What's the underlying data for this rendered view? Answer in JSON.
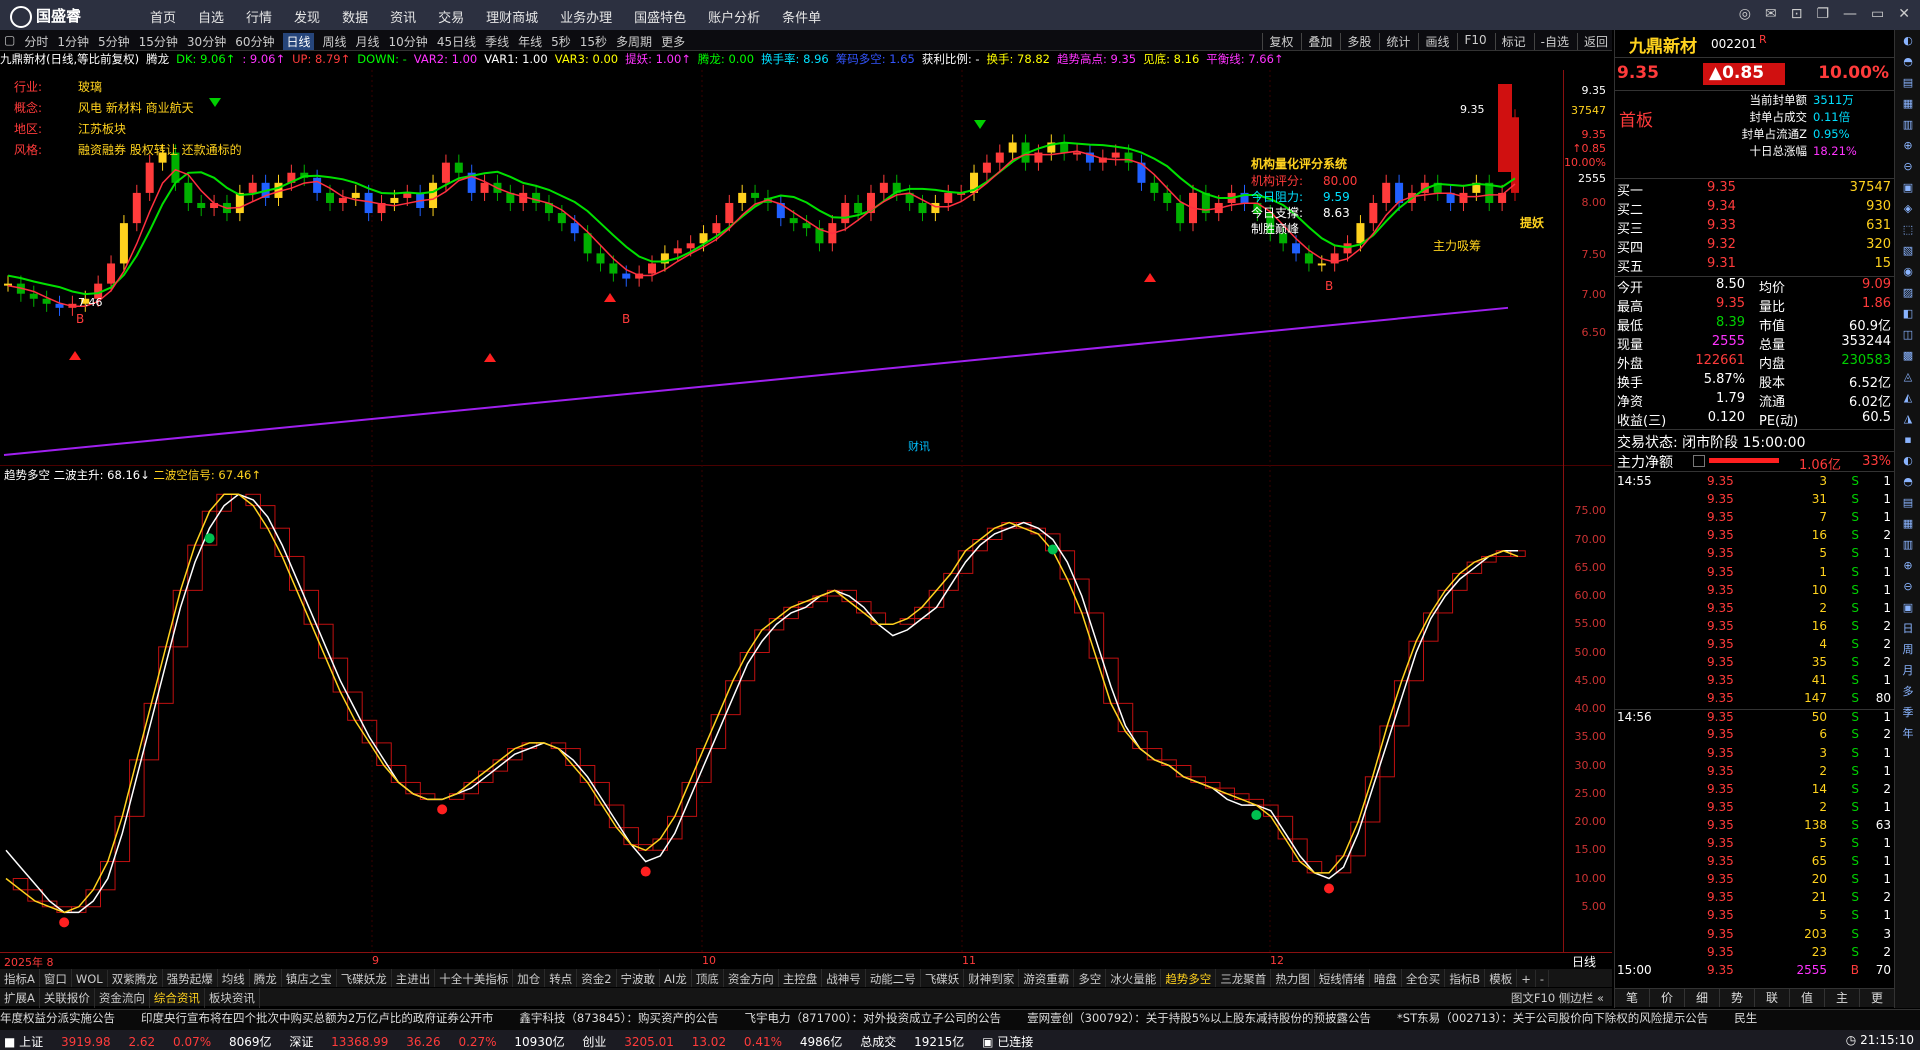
{
  "topbar": {
    "logo": "国盛睿",
    "menu": [
      "首页",
      "自选",
      "行情",
      "发现",
      "数据",
      "资讯",
      "交易",
      "理财商城",
      "业务办理",
      "国盛特色",
      "账户分析",
      "条件单"
    ]
  },
  "periodbar": {
    "items": [
      "分时",
      "1分钟",
      "5分钟",
      "15分钟",
      "30分钟",
      "60分钟",
      "日线",
      "周线",
      "月线",
      "10分钟",
      "45日线",
      "季线",
      "年线",
      "5秒",
      "15秒",
      "多周期",
      "更多"
    ],
    "active_index": 6,
    "right": [
      "复权",
      "叠加",
      "多股",
      "统计",
      "画线",
      "F10",
      "标记",
      "-自选",
      "返回"
    ]
  },
  "indicator_line": [
    {
      "t": "九鼎新材(日线,等比前复权)",
      "c": "#ffffff"
    },
    {
      "t": "腾龙",
      "c": "#ffffff"
    },
    {
      "t": "DK: 9.06↑",
      "c": "#00ff00"
    },
    {
      "t": ": 9.06↑",
      "c": "#ff33ff"
    },
    {
      "t": "UP: 8.79↑",
      "c": "#ff3b3b"
    },
    {
      "t": "DOWN: -",
      "c": "#00ff00"
    },
    {
      "t": "VAR2: 1.00",
      "c": "#ff33ff"
    },
    {
      "t": "VAR1: 1.00",
      "c": "#ffffff"
    },
    {
      "t": "VAR3: 0.00",
      "c": "#ffff00"
    },
    {
      "t": "提妖: 1.00↑",
      "c": "#ff33ff"
    },
    {
      "t": "腾龙: 0.00",
      "c": "#00ff00"
    },
    {
      "t": "换手率: 8.96",
      "c": "#00e0ff"
    },
    {
      "t": "筹码多空: 1.65",
      "c": "#3355ff"
    },
    {
      "t": "获利比例: -",
      "c": "#ffffff"
    },
    {
      "t": "换手: 78.82",
      "c": "#ffff00"
    },
    {
      "t": "趋势高点: 9.35",
      "c": "#ff33ff"
    },
    {
      "t": "见底: 8.16",
      "c": "#ffff00"
    },
    {
      "t": "平衡线: 7.66↑",
      "c": "#ff33ff"
    }
  ],
  "stock_info": [
    {
      "label": "行业:",
      "value": "玻璃"
    },
    {
      "label": "概念:",
      "value": "风电 新材料 商业航天"
    },
    {
      "label": "地区:",
      "value": "江苏板块"
    },
    {
      "label": "风格:",
      "value": "融资融券 股权转让 还款通标的"
    }
  ],
  "rating_box": {
    "title": "机构量化评分系统",
    "lines": [
      {
        "label": "机构评分:",
        "value": "80.00",
        "c": "#ff3b3b"
      },
      {
        "label": "今日阻力:",
        "value": "9.59",
        "c": "#00e0ff"
      },
      {
        "label": "今日支撑:",
        "value": "8.63",
        "c": "#ffffff"
      },
      {
        "label": "制胜巅峰",
        "value": "",
        "c": "#ffffff"
      }
    ]
  },
  "chart_labels": {
    "high_price": "9.35",
    "low_price": "7.46",
    "b_label": "B",
    "tiyao": "提妖",
    "zhuli": "主力吸筹",
    "caixun": "财讯"
  },
  "osc_header": {
    "name": "趋势多空",
    "a": "二波主升: 68.16↓",
    "b": "二波空信号: 67.46↑"
  },
  "price_scale": [
    "9.35",
    "37547",
    "9.35",
    "↑0.85",
    "10.00%",
    "2555",
    "8.00",
    "7.50",
    "7.00",
    "6.50"
  ],
  "osc_scale": [
    "75.00",
    "70.00",
    "65.00",
    "60.00",
    "55.00",
    "50.00",
    "45.00",
    "40.00",
    "35.00",
    "30.00",
    "25.00",
    "20.00",
    "15.00",
    "10.00",
    "5.00"
  ],
  "dates": {
    "year_label": "2025年 8",
    "labels": [
      "9",
      "10",
      "11",
      "12"
    ],
    "period": "日线"
  },
  "chart_data": {
    "type": "candlestick",
    "price_series": {
      "open": [
        7.7,
        7.7,
        7.6,
        7.55,
        7.5,
        7.46,
        7.5,
        7.55,
        7.7,
        7.9,
        8.3,
        8.6,
        8.9,
        9.0,
        8.7,
        8.5,
        8.45,
        8.5,
        8.4,
        8.6,
        8.7,
        8.55,
        8.7,
        8.8,
        8.75,
        8.6,
        8.5,
        8.55,
        8.6,
        8.4,
        8.5,
        8.55,
        8.6,
        8.45,
        8.7,
        8.9,
        8.8,
        8.6,
        8.7,
        8.6,
        8.5,
        8.6,
        8.5,
        8.4,
        8.3,
        8.2,
        8.0,
        7.9,
        7.8,
        7.75,
        7.8,
        7.9,
        8.0,
        8.05,
        8.1,
        8.2,
        8.3,
        8.5,
        8.6,
        8.55,
        8.5,
        8.35,
        8.3,
        8.25,
        8.1,
        8.3,
        8.5,
        8.4,
        8.6,
        8.7,
        8.6,
        8.5,
        8.4,
        8.5,
        8.6,
        8.6,
        8.8,
        8.9,
        9.0,
        9.1,
        8.9,
        9.0,
        9.1,
        9.0,
        9.0,
        8.9,
        8.95,
        9.0,
        8.9,
        8.7,
        8.6,
        8.5,
        8.3,
        8.6,
        8.4,
        8.5,
        8.6,
        8.5,
        8.4,
        8.2,
        8.1,
        8.0,
        7.9,
        7.9,
        8.0,
        8.1,
        8.3,
        8.5,
        8.7,
        8.5,
        8.6,
        8.7,
        8.6,
        8.5,
        8.6,
        8.7,
        8.5,
        8.6
      ],
      "close": [
        7.7,
        7.6,
        7.55,
        7.5,
        7.46,
        7.5,
        7.55,
        7.7,
        7.9,
        8.3,
        8.6,
        8.9,
        9.0,
        8.7,
        8.5,
        8.45,
        8.5,
        8.4,
        8.6,
        8.7,
        8.55,
        8.7,
        8.8,
        8.75,
        8.6,
        8.5,
        8.55,
        8.6,
        8.4,
        8.5,
        8.55,
        8.6,
        8.45,
        8.7,
        8.9,
        8.8,
        8.6,
        8.7,
        8.6,
        8.5,
        8.6,
        8.5,
        8.4,
        8.3,
        8.2,
        8.0,
        7.9,
        7.8,
        7.75,
        7.8,
        7.9,
        8.0,
        8.05,
        8.1,
        8.2,
        8.3,
        8.5,
        8.6,
        8.55,
        8.5,
        8.35,
        8.3,
        8.25,
        8.1,
        8.3,
        8.5,
        8.4,
        8.6,
        8.7,
        8.6,
        8.5,
        8.4,
        8.5,
        8.6,
        8.6,
        8.8,
        8.9,
        9.0,
        9.1,
        8.9,
        9.0,
        9.1,
        9.0,
        9.0,
        8.9,
        8.95,
        9.0,
        8.9,
        8.7,
        8.6,
        8.5,
        8.3,
        8.6,
        8.4,
        8.5,
        8.6,
        8.5,
        8.4,
        8.2,
        8.1,
        8.0,
        7.9,
        7.9,
        8.0,
        8.1,
        8.3,
        8.5,
        8.7,
        8.5,
        8.6,
        8.7,
        8.6,
        8.5,
        8.6,
        8.7,
        8.5,
        8.6,
        9.35
      ],
      "ma_long_start": 6.0,
      "ma_long_end": 7.46,
      "price_range": [
        6.0,
        9.7
      ]
    },
    "osc_series": {
      "white": [
        15,
        12,
        9,
        6,
        4,
        4,
        6,
        10,
        18,
        28,
        38,
        48,
        58,
        66,
        72,
        76,
        78,
        77,
        74,
        69,
        63,
        57,
        51,
        45,
        40,
        35,
        31,
        27,
        25,
        24,
        24,
        25,
        26,
        28,
        30,
        32,
        33,
        34,
        33,
        31,
        28,
        24,
        20,
        16,
        13,
        14,
        18,
        24,
        30,
        36,
        42,
        48,
        52,
        55,
        57,
        58,
        60,
        61,
        60,
        58,
        55,
        53,
        54,
        56,
        58,
        62,
        66,
        69,
        71,
        72,
        73,
        72,
        70,
        66,
        60,
        52,
        44,
        37,
        33,
        31,
        30,
        28,
        27,
        26,
        24,
        23,
        23,
        22,
        18,
        14,
        11,
        10,
        12,
        18,
        26,
        34,
        42,
        50,
        56,
        60,
        63,
        65,
        67,
        68,
        68
      ],
      "yellow": [
        10,
        8,
        6,
        5,
        4,
        5,
        8,
        13,
        21,
        31,
        41,
        51,
        61,
        69,
        75,
        78,
        78,
        76,
        72,
        67,
        61,
        55,
        49,
        43,
        38,
        34,
        30,
        27,
        25,
        24,
        24,
        25,
        27,
        29,
        31,
        33,
        34,
        34,
        33,
        30,
        27,
        23,
        19,
        16,
        15,
        17,
        21,
        27,
        33,
        39,
        45,
        50,
        54,
        56,
        58,
        59,
        60,
        61,
        59,
        57,
        55,
        55,
        56,
        58,
        61,
        64,
        68,
        70,
        72,
        73,
        72,
        71,
        68,
        63,
        57,
        49,
        41,
        36,
        33,
        31,
        30,
        28,
        27,
        26,
        25,
        24,
        23,
        21,
        17,
        13,
        11,
        11,
        14,
        20,
        28,
        37,
        45,
        52,
        57,
        61,
        64,
        66,
        67,
        68,
        67
      ],
      "y_range": [
        0,
        80
      ]
    }
  },
  "quote": {
    "name": "九鼎新材",
    "code": "002201",
    "flag": "R",
    "price": "9.35",
    "change": "▲0.85",
    "pct": "10.00%",
    "board": "首板",
    "seal_stats": [
      {
        "label": "当前封单额",
        "value": "3511万"
      },
      {
        "label": "封单占成交",
        "value": "0.11倍"
      },
      {
        "label": "封单占流通Z",
        "value": "0.95%"
      },
      {
        "label": "十日总涨幅",
        "value": "18.21%"
      }
    ],
    "buy_levels": [
      {
        "label": "买一",
        "price": "9.35",
        "vol": "37547"
      },
      {
        "label": "买二",
        "price": "9.34",
        "vol": "930"
      },
      {
        "label": "买三",
        "price": "9.33",
        "vol": "631"
      },
      {
        "label": "买四",
        "price": "9.32",
        "vol": "320"
      },
      {
        "label": "买五",
        "price": "9.31",
        "vol": "15"
      }
    ],
    "stats": [
      {
        "l1": "今开",
        "v1": "8.50",
        "c1": "#ffffff",
        "l2": "均价",
        "v2": "9.09",
        "c2": "#ff3b3b"
      },
      {
        "l1": "最高",
        "v1": "9.35",
        "c1": "#ff3b3b",
        "l2": "量比",
        "v2": "1.86",
        "c2": "#ff3b3b"
      },
      {
        "l1": "最低",
        "v1": "8.39",
        "c1": "#00d000",
        "l2": "市值",
        "v2": "60.9亿",
        "c2": "#ffffff"
      },
      {
        "l1": "现量",
        "v1": "2555",
        "c1": "#ff33ff",
        "l2": "总量",
        "v2": "353244",
        "c2": "#ffffff"
      },
      {
        "l1": "外盘",
        "v1": "122661",
        "c1": "#ff3b3b",
        "l2": "内盘",
        "v2": "230583",
        "c2": "#00d000"
      },
      {
        "l1": "换手",
        "v1": "5.87%",
        "c1": "#ffffff",
        "l2": "股本",
        "v2": "6.52亿",
        "c2": "#ffffff"
      },
      {
        "l1": "净资",
        "v1": "1.79",
        "c1": "#ffffff",
        "l2": "流通",
        "v2": "6.02亿",
        "c2": "#ffffff"
      },
      {
        "l1": "收益(三)",
        "v1": "0.120",
        "c1": "#ffffff",
        "l2": "PE(动)",
        "v2": "60.5",
        "c2": "#ffffff"
      }
    ],
    "trade_status": "交易状态: 闭市阶段 15:00:00",
    "main_flow_label": "主力净额",
    "main_flow_value": "1.06亿",
    "main_flow_pct": "33%",
    "ticks": [
      {
        "time": "14:55",
        "p": "9.35",
        "v": "3",
        "s": "S",
        "n": "1"
      },
      {
        "time": "",
        "p": "9.35",
        "v": "31",
        "s": "S",
        "n": "1"
      },
      {
        "time": "",
        "p": "9.35",
        "v": "7",
        "s": "S",
        "n": "1"
      },
      {
        "time": "",
        "p": "9.35",
        "v": "16",
        "s": "S",
        "n": "2"
      },
      {
        "time": "",
        "p": "9.35",
        "v": "5",
        "s": "S",
        "n": "1"
      },
      {
        "time": "",
        "p": "9.35",
        "v": "1",
        "s": "S",
        "n": "1"
      },
      {
        "time": "",
        "p": "9.35",
        "v": "10",
        "s": "S",
        "n": "1"
      },
      {
        "time": "",
        "p": "9.35",
        "v": "2",
        "s": "S",
        "n": "1"
      },
      {
        "time": "",
        "p": "9.35",
        "v": "16",
        "s": "S",
        "n": "2"
      },
      {
        "time": "",
        "p": "9.35",
        "v": "4",
        "s": "S",
        "n": "2"
      },
      {
        "time": "",
        "p": "9.35",
        "v": "35",
        "s": "S",
        "n": "2"
      },
      {
        "time": "",
        "p": "9.35",
        "v": "41",
        "s": "S",
        "n": "1"
      },
      {
        "time": "",
        "p": "9.35",
        "v": "147",
        "s": "S",
        "n": "80"
      },
      {
        "time": "14:56",
        "p": "9.35",
        "v": "50",
        "s": "S",
        "n": "1"
      },
      {
        "time": "",
        "p": "9.35",
        "v": "6",
        "s": "S",
        "n": "2"
      },
      {
        "time": "",
        "p": "9.35",
        "v": "3",
        "s": "S",
        "n": "1"
      },
      {
        "time": "",
        "p": "9.35",
        "v": "2",
        "s": "S",
        "n": "1"
      },
      {
        "time": "",
        "p": "9.35",
        "v": "14",
        "s": "S",
        "n": "2"
      },
      {
        "time": "",
        "p": "9.35",
        "v": "2",
        "s": "S",
        "n": "1"
      },
      {
        "time": "",
        "p": "9.35",
        "v": "138",
        "s": "S",
        "n": "63"
      },
      {
        "time": "",
        "p": "9.35",
        "v": "5",
        "s": "S",
        "n": "1"
      },
      {
        "time": "",
        "p": "9.35",
        "v": "65",
        "s": "S",
        "n": "1"
      },
      {
        "time": "",
        "p": "9.35",
        "v": "20",
        "s": "S",
        "n": "1"
      },
      {
        "time": "",
        "p": "9.35",
        "v": "21",
        "s": "S",
        "n": "2"
      },
      {
        "time": "",
        "p": "9.35",
        "v": "5",
        "s": "S",
        "n": "1"
      },
      {
        "time": "",
        "p": "9.35",
        "v": "203",
        "s": "S",
        "n": "3"
      },
      {
        "time": "",
        "p": "9.35",
        "v": "23",
        "s": "S",
        "n": "2"
      },
      {
        "time": "15:00",
        "p": "9.35",
        "v": "2555",
        "s": "B",
        "n": "70"
      }
    ],
    "bottom_tabs": [
      "笔",
      "价",
      "细",
      "势",
      "联",
      "值",
      "主",
      "更"
    ]
  },
  "right_tools": [
    "日",
    "周",
    "月",
    "多",
    "季",
    "年"
  ],
  "tabs_row1": [
    "指标A",
    "窗口",
    "WOL",
    "双紫腾龙",
    "强势起爆",
    "均线",
    "腾龙",
    "镇店之宝",
    "飞碟妖龙",
    "主进出",
    "十全十美指标",
    "加仓",
    "转点",
    "资金2",
    "宁波敢",
    "AI龙",
    "顶底",
    "资金方向",
    "主控盘",
    "战神号",
    "动能二号",
    "飞碟妖",
    "财神到家",
    "游资重霸",
    "多空",
    "冰火量能",
    "趋势多空",
    "三龙聚首",
    "热力图",
    "短线情绪",
    "暗盘",
    "全仓买"
  ],
  "tabs_row1_active": 26,
  "tabs_row1_right": [
    "指标B",
    "模板",
    "+",
    "-"
  ],
  "tabs_row2": [
    "扩展A",
    "关联报价",
    "资金流向",
    "综合资讯",
    "板块资讯"
  ],
  "tabs_row2_active": 3,
  "tabs_row2_right": "图文F10 侧边栏 «",
  "news": [
    "年度权益分派实施公告",
    "印度央行宣布将在四个批次中购买总额为2万亿卢比的政府证券公开市",
    "鑫宇科技（873845）：购买资产的公告",
    "飞宇电力（871700）：对外投资成立子公司的公告",
    "壹网壹创（300792）：关于持股5%以上股东减持股份的预披露公告",
    "*ST东易（002713）：关于公司股价向下除权的风险提示公告",
    "民生"
  ],
  "status": {
    "sh_label": "上证",
    "sh": "3919.98",
    "sh_chg": "2.62",
    "sh_pct": "0.07%",
    "sh_amt": "8069亿",
    "sz_label": "深证",
    "sz": "13368.99",
    "sz_chg": "36.26",
    "sz_pct": "0.27%",
    "sz_amt": "10930亿",
    "cy_label": "创业",
    "cy": "3205.01",
    "cy_chg": "13.02",
    "cy_pct": "0.41%",
    "cy_amt": "4986亿",
    "total_label": "总成交",
    "total": "19215亿",
    "conn": "已连接",
    "time": "21:15:10"
  }
}
